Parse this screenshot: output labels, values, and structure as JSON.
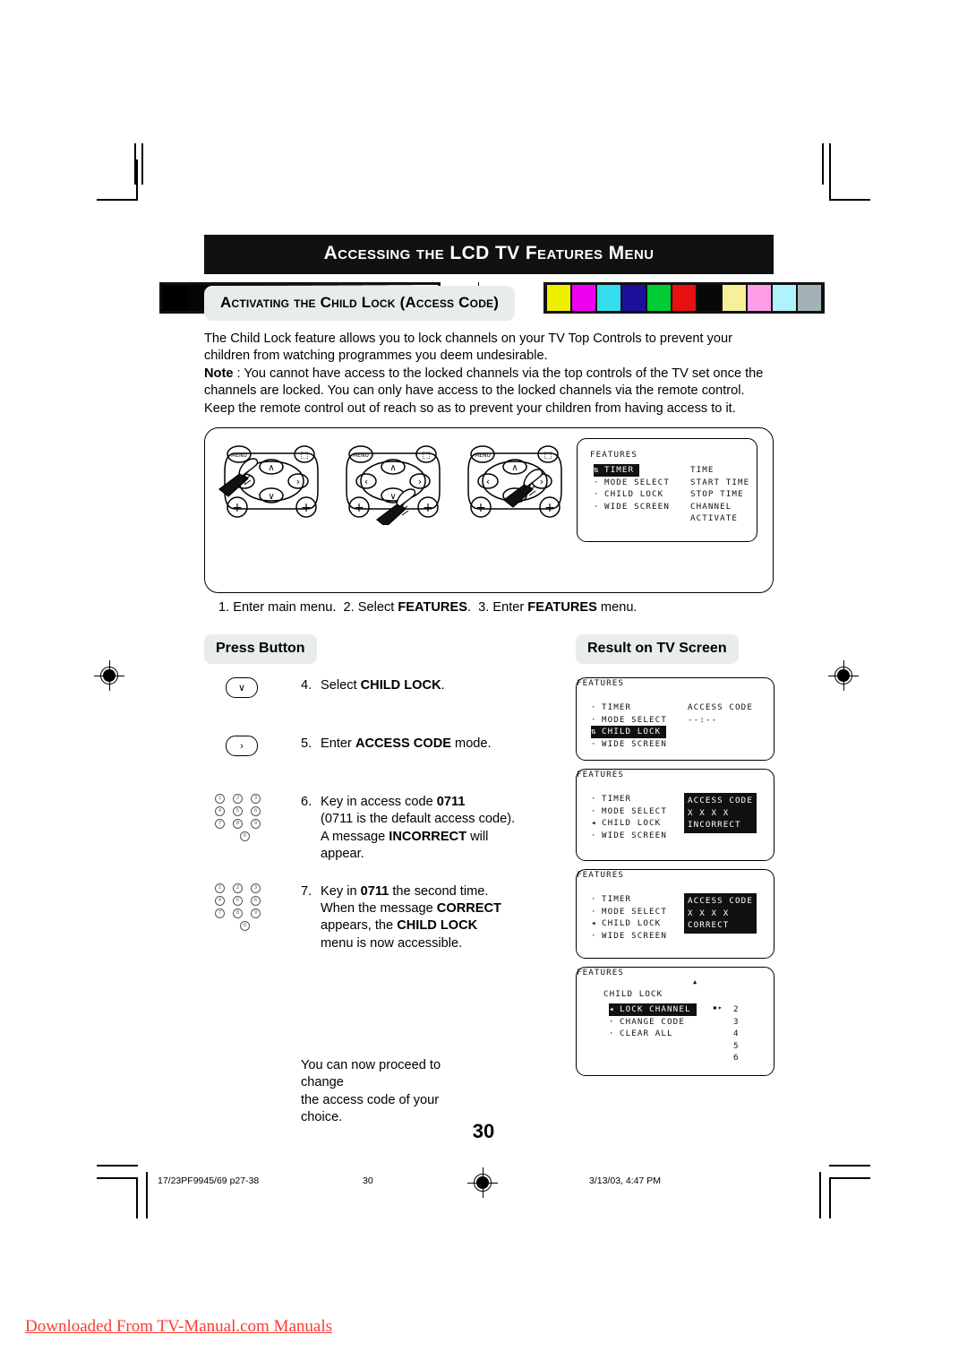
{
  "header": {
    "title": "Accessing the LCD TV Features Menu",
    "subtitle": "Activating the Child Lock (Access Code)"
  },
  "body": {
    "para1": "The Child Lock feature allows you to lock channels on your TV  Top Controls to prevent your children from watching programmes you deem undesirable.",
    "note_label": "Note",
    "note_sep": " :  ",
    "note_text": "You cannot have access to the locked channels via the top controls of the TV set once the channels are locked.  You can only have access to the locked channels via the remote control. Keep the remote control out of reach so as to prevent your children from having access to it."
  },
  "illustration": {
    "caption_1": "1. Enter main menu.",
    "caption_2": "2. Select ",
    "caption_2_bold": "FEATURES",
    "caption_2_end": ".",
    "caption_3": "3. Enter ",
    "caption_3_bold": "FEATURES",
    "caption_3_end": " menu.",
    "remote_menu_label": "MENU",
    "remote_up": "∧",
    "remote_down": "∨",
    "remote_left": "‹",
    "remote_right": "›",
    "remote_plus": "+",
    "remote_wide": "⬚"
  },
  "top_screen": {
    "header": "FEATURES",
    "items": [
      {
        "label": "TIMER",
        "highlighted": true,
        "marker": "updown"
      },
      {
        "label": "MODE SELECT",
        "highlighted": false,
        "marker": "dot"
      },
      {
        "label": "CHILD LOCK",
        "highlighted": false,
        "marker": "dot"
      },
      {
        "label": "WIDE SCREEN",
        "highlighted": false,
        "marker": "dot"
      }
    ],
    "right_column": [
      "TIME",
      "START TIME",
      "STOP TIME",
      "CHANNEL",
      "ACTIVATE"
    ]
  },
  "columns": {
    "press_button": "Press Button",
    "result_on_tv": "Result on TV Screen"
  },
  "steps": [
    {
      "number": "4.",
      "icon": "down-arrow-button",
      "icon_glyph": "∨",
      "lines": [
        [
          {
            "t": "Select ",
            "b": false
          },
          {
            "t": "CHILD LOCK",
            "b": true
          },
          {
            "t": ".",
            "b": false
          }
        ]
      ]
    },
    {
      "number": "5.",
      "icon": "right-arrow-button",
      "icon_glyph": "›",
      "lines": [
        [
          {
            "t": "Enter ",
            "b": false
          },
          {
            "t": "ACCESS CODE",
            "b": true
          },
          {
            "t": " mode.",
            "b": false
          }
        ]
      ]
    },
    {
      "number": "6.",
      "icon": "numeric-keypad",
      "icon_glyph": "",
      "lines": [
        [
          {
            "t": "Key in access code ",
            "b": false
          },
          {
            "t": "0711",
            "b": true
          }
        ],
        [
          {
            "t": "(0711 is the default access code).",
            "b": false
          }
        ],
        [
          {
            "t": "A message ",
            "b": false
          },
          {
            "t": "INCORRECT",
            "b": true
          },
          {
            "t": " will",
            "b": false
          }
        ],
        [
          {
            "t": "appear.",
            "b": false
          }
        ]
      ]
    },
    {
      "number": "7.",
      "icon": "numeric-keypad",
      "icon_glyph": "",
      "lines": [
        [
          {
            "t": "Key in ",
            "b": false
          },
          {
            "t": "0711",
            "b": true
          },
          {
            "t": " the second time.",
            "b": false
          }
        ],
        [
          {
            "t": "When the message ",
            "b": false
          },
          {
            "t": "CORRECT",
            "b": true
          }
        ],
        [
          {
            "t": "appears, the ",
            "b": false
          },
          {
            "t": "CHILD LOCK",
            "b": true
          }
        ],
        [
          {
            "t": "menu is now accessible.",
            "b": false
          }
        ]
      ]
    }
  ],
  "closing_note": {
    "line1": "You can now proceed to change",
    "line2": "the access code of your choice."
  },
  "keypad_keys": [
    "1",
    "2",
    "3",
    "4",
    "5",
    "6",
    "7",
    "8",
    "9",
    "0"
  ],
  "result_screens": [
    {
      "header": "FEATURES",
      "items": [
        {
          "label": "TIMER",
          "highlighted": false,
          "marker": "dot"
        },
        {
          "label": "MODE SELECT",
          "highlighted": false,
          "marker": "dot"
        },
        {
          "label": "CHILD LOCK",
          "highlighted": true,
          "marker": "updown"
        },
        {
          "label": "WIDE SCREEN",
          "highlighted": false,
          "marker": "dot"
        }
      ],
      "right_column": [
        "ACCESS CODE",
        "--:--"
      ],
      "right_highlighted": false
    },
    {
      "header": "FEATURES",
      "items": [
        {
          "label": "TIMER",
          "highlighted": false,
          "marker": "dot"
        },
        {
          "label": "MODE SELECT",
          "highlighted": false,
          "marker": "dot"
        },
        {
          "label": "CHILD LOCK",
          "highlighted": false,
          "marker": "arrow"
        },
        {
          "label": "WIDE SCREEN",
          "highlighted": false,
          "marker": "dot"
        }
      ],
      "right_column": [
        "ACCESS CODE",
        "X X X X",
        "INCORRECT"
      ],
      "right_highlighted": true
    },
    {
      "header": "FEATURES",
      "items": [
        {
          "label": "TIMER",
          "highlighted": false,
          "marker": "dot"
        },
        {
          "label": "MODE SELECT",
          "highlighted": false,
          "marker": "dot"
        },
        {
          "label": "CHILD LOCK",
          "highlighted": false,
          "marker": "arrow"
        },
        {
          "label": "WIDE SCREEN",
          "highlighted": false,
          "marker": "dot"
        }
      ],
      "right_column": [
        "ACCESS CODE",
        "X X X X",
        "CORRECT"
      ],
      "right_highlighted": true
    }
  ],
  "child_lock_screen": {
    "header": "FEATURES",
    "submenu_title": "CHILD LOCK",
    "up_caret": "▲",
    "items": [
      {
        "label": "LOCK CHANNEL",
        "highlighted": true,
        "marker": "arrow"
      },
      {
        "label": "CHANGE CODE",
        "highlighted": false,
        "marker": "dot"
      },
      {
        "label": "CLEAR ALL",
        "highlighted": false,
        "marker": "dot"
      }
    ],
    "lock_channel_arrows": "▪▸",
    "channel_numbers": [
      "2",
      "3",
      "4",
      "5",
      "6"
    ]
  },
  "page_number": "30",
  "footer": {
    "file_ref": "17/23PF9945/69 p27-38",
    "page": "30",
    "timestamp": "3/13/03, 4:47 PM"
  },
  "watermark": "Downloaded From TV-Manual.com Manuals",
  "colors": {
    "title_bg": "#111111",
    "pill_bg": "#e8ecea",
    "watermark": "#ff3b30",
    "grayscale": [
      "#000000",
      "#050505",
      "#0c0c0c",
      "#141414",
      "#232323",
      "#3a3a3a",
      "#575757",
      "#7b7b7b",
      "#a5a5a5",
      "#d4d4d4",
      "#ffffff"
    ],
    "colorbars": [
      "#eeee00",
      "#ee00ee",
      "#33ddee",
      "#1a109c",
      "#00cc33",
      "#e81010",
      "#070707",
      "#f7f09a",
      "#ff9de8",
      "#b0f4fb",
      "#a3b3b5"
    ]
  }
}
